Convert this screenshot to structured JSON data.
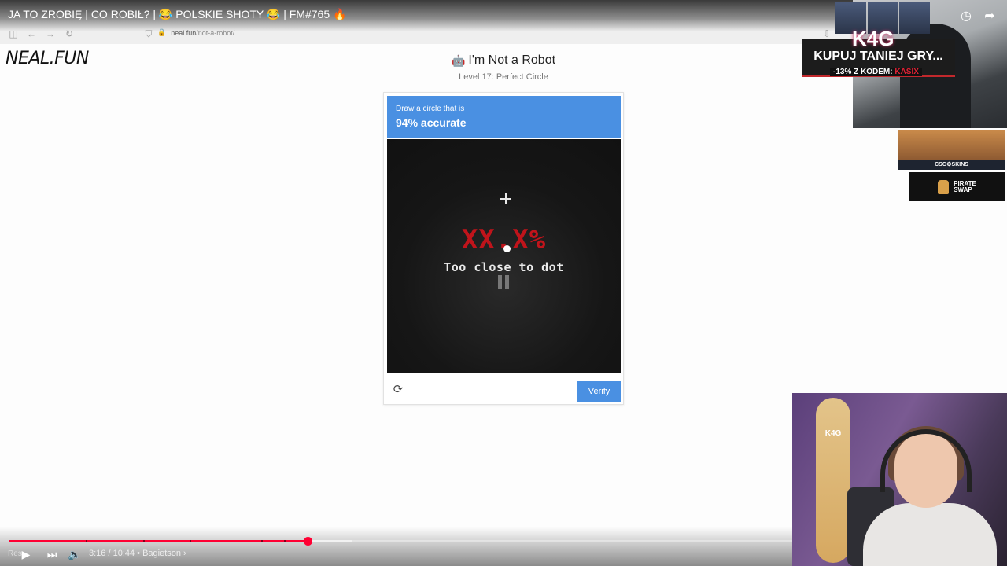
{
  "video": {
    "title": "JA TO ZROBIĘ | CO ROBIŁ? | 😂 POLSKIE SHOTY 😂 | FM#765 🔥",
    "time": "3:16 / 10:44 • Bagietson ›",
    "res_label": "Res",
    "progress": 0.3813,
    "buffered": 0.4385
  },
  "browser": {
    "url_host": "neal.fun",
    "url_path": "/not-a-robot/"
  },
  "site": {
    "logo": "NEAL.FUN"
  },
  "header": {
    "robot_icon": "🤖",
    "title": "I'm Not a Robot",
    "subtitle": "Level 17: Perfect Circle"
  },
  "captcha": {
    "prompt_line1": "Draw a circle that is",
    "prompt_line2": "94% accurate",
    "score": "XX.X%",
    "message": "Too close to dot",
    "verify_label": "Verify",
    "accent": "#4a90e2"
  },
  "promo": {
    "brand": "K4G",
    "headline": "KUPUJ TANIEJ GRY...",
    "code_prefix": "-13% Z KODEM:",
    "code": "KASIX"
  },
  "sponsors": {
    "first": "CSG⚙SKINS",
    "second_line1": "PIRATE",
    "second_line2": "SWAP"
  },
  "webcam": {
    "board_logo": "K4G"
  }
}
